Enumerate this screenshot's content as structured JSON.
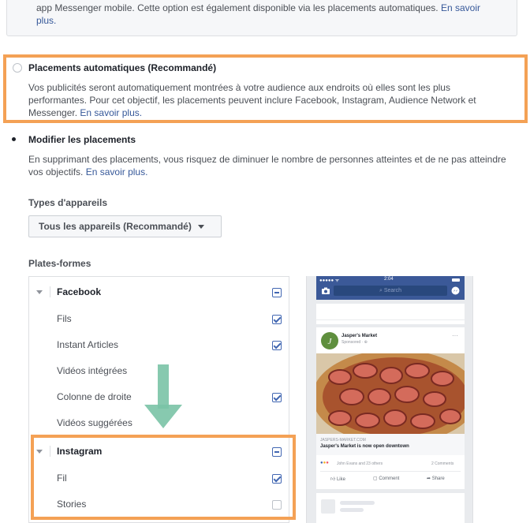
{
  "info_box": {
    "text": "app Messenger mobile. Cette option est également disponible via les placements automatiques.",
    "link": "En savoir plus."
  },
  "automatic": {
    "title": "Placements automatiques (Recommandé)",
    "desc": "Vos publicités seront automatiquement montrées à votre audience aux endroits où elles sont les plus performantes. Pour cet objectif, les placements peuvent inclure Facebook, Instagram, Audience Network et Messenger.",
    "link": "En savoir plus.",
    "selected": false
  },
  "manual": {
    "title": "Modifier les placements",
    "desc": "En supprimant des placements, vous risquez de diminuer le nombre de personnes atteintes et de ne pas atteindre vos objectifs.",
    "link": "En savoir plus.",
    "selected": true
  },
  "device_types": {
    "label": "Types d'appareils",
    "value": "Tous les appareils (Recommandé)"
  },
  "platforms": {
    "label": "Plates-formes",
    "groups": [
      {
        "name": "Facebook",
        "state": "indeterminate",
        "items": [
          {
            "name": "Fils",
            "checked": true
          },
          {
            "name": "Instant Articles",
            "checked": true
          },
          {
            "name": "Vidéos intégrées",
            "checked": null
          },
          {
            "name": "Colonne de droite",
            "checked": true
          },
          {
            "name": "Vidéos suggérées",
            "checked": null
          }
        ]
      },
      {
        "name": "Instagram",
        "state": "indeterminate",
        "items": [
          {
            "name": "Fil",
            "checked": true
          },
          {
            "name": "Stories",
            "checked": false
          }
        ]
      }
    ]
  },
  "preview": {
    "status_left": "●●●●● ᯤ",
    "status_time": "2:04",
    "search": "Search",
    "page_name": "Jasper's Market",
    "sponsored": "Sponsored · ⊕",
    "domain": "JASPERS-MARKET.COM",
    "headline": "Jasper's Market is now open downtown",
    "reactions": "John Evans and 23 others",
    "comments": "2 Comments",
    "like": "Like",
    "comment": "Comment",
    "share": "Share"
  },
  "colors": {
    "highlight": "#f4a155",
    "arrow": "#7ac3a6",
    "link": "#365899",
    "fb_blue": "#3b5998"
  }
}
